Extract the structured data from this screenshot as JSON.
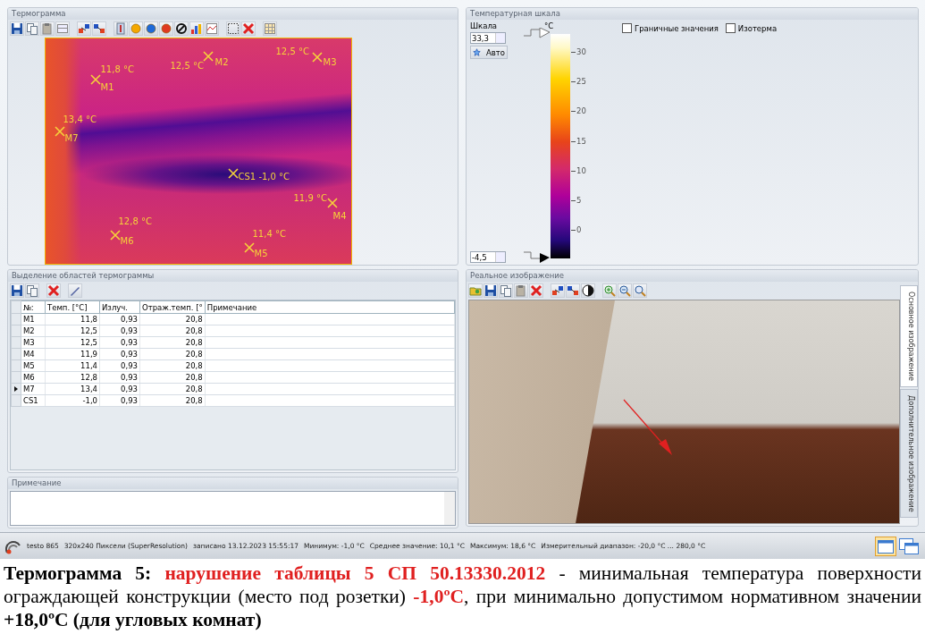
{
  "thermogram_panel": {
    "title": "Термограмма",
    "markers": [
      {
        "name": "M1",
        "reading": "11,8 °C"
      },
      {
        "name": "M2",
        "reading": "12,5 °C"
      },
      {
        "name": "M3",
        "reading": "12,5 °C"
      },
      {
        "name": "M7",
        "reading": "13,4 °C"
      },
      {
        "name": "CS1",
        "reading": "-1,0 °C"
      },
      {
        "name": "M4",
        "reading": "11,9 °C"
      },
      {
        "name": "M6",
        "reading": "12,8 °C"
      },
      {
        "name": "M5",
        "reading": "11,4 °C"
      }
    ]
  },
  "scale_panel": {
    "title": "Температурная шкала",
    "scale_label": "Шкала",
    "max_value": "33,3",
    "min_value": "-4,5",
    "auto_button": "Авто",
    "unit": "°C",
    "ticks": [
      "30",
      "25",
      "20",
      "15",
      "10",
      "5",
      "0"
    ],
    "checkboxes": [
      {
        "label": "Граничные значения",
        "checked": false
      },
      {
        "label": "Изотерма",
        "checked": false
      }
    ]
  },
  "regions_panel": {
    "title": "Выделение областей термограммы",
    "columns": [
      "№:",
      "Темп. [°C]",
      "Излуч.",
      "Отраж.темп. [°",
      "Примечание"
    ],
    "rows": [
      {
        "cells": [
          "M1",
          "11,8",
          "0,93",
          "20,8",
          ""
        ],
        "selected": false
      },
      {
        "cells": [
          "M2",
          "12,5",
          "0,93",
          "20,8",
          ""
        ],
        "selected": false
      },
      {
        "cells": [
          "M3",
          "12,5",
          "0,93",
          "20,8",
          ""
        ],
        "selected": false
      },
      {
        "cells": [
          "M4",
          "11,9",
          "0,93",
          "20,8",
          ""
        ],
        "selected": false
      },
      {
        "cells": [
          "M5",
          "11,4",
          "0,93",
          "20,8",
          ""
        ],
        "selected": false
      },
      {
        "cells": [
          "M6",
          "12,8",
          "0,93",
          "20,8",
          ""
        ],
        "selected": false
      },
      {
        "cells": [
          "M7",
          "13,4",
          "0,93",
          "20,8",
          ""
        ],
        "selected": true
      },
      {
        "cells": [
          "CS1",
          "-1,0",
          "0,93",
          "20,8",
          ""
        ],
        "selected": false
      }
    ]
  },
  "note_panel": {
    "title": "Примечание"
  },
  "real_image_panel": {
    "title": "Реальное изображение",
    "tabs": [
      {
        "label": "Основное изображение",
        "selected": true
      },
      {
        "label": "Дополнительное изображение",
        "selected": false
      }
    ]
  },
  "status_bar": {
    "fields": [
      "testo 865",
      "320x240 Пиксели (SuperResolution)",
      "записано 13.12.2023 15:55:17",
      "Минимум: -1,0 °C",
      "Среднее значение: 10,1 °C",
      "Максимум: 18,6 °C",
      "Измерительный диапазон: -20,0 °C ... 280,0 °C"
    ]
  },
  "caption": {
    "segments": [
      {
        "text": "Термограмма  5: ",
        "kind": "bold"
      },
      {
        "text": "нарушение таблицы 5 СП 50.13330.2012",
        "kind": "alert"
      },
      {
        "text": " - минимальная температура поверхности ограждающей конструкции (место под розетки) ",
        "kind": "plain"
      },
      {
        "text": "-1,0ºC",
        "kind": "alert"
      },
      {
        "text": ", при минимально допустимом нормативном значении ",
        "kind": "plain"
      },
      {
        "text": "+18,0ºC (для угловых комнат)",
        "kind": "bold"
      }
    ]
  }
}
